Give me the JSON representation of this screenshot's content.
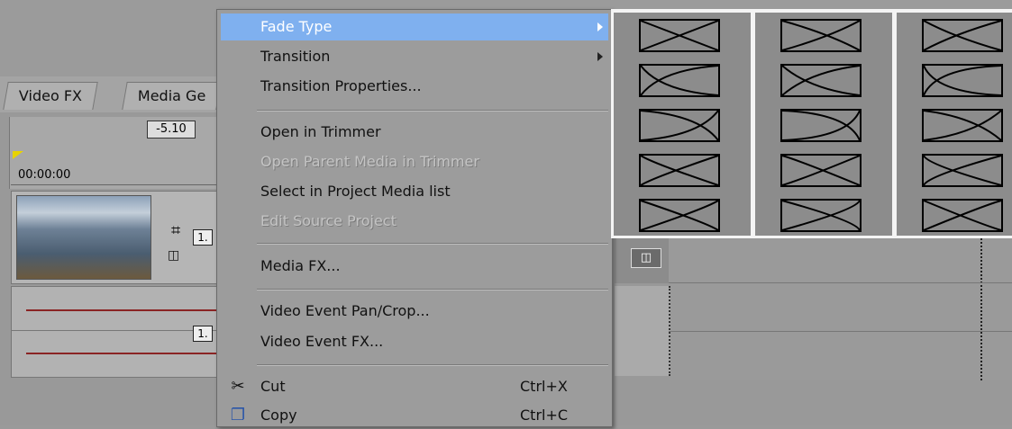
{
  "tabs": [
    {
      "label": "Video FX"
    },
    {
      "label": "Media Ge"
    }
  ],
  "timeline": {
    "time_badge": "-5.10",
    "timecode": "00:00:00",
    "event_label_1": "1.",
    "event_label_2": "1."
  },
  "menu": {
    "items": [
      {
        "label": "Fade Type",
        "submenu": true,
        "state": "highlighted"
      },
      {
        "label": "Transition",
        "submenu": true
      },
      {
        "label": "Transition Properties..."
      },
      {
        "label": "Open in Trimmer"
      },
      {
        "label": "Open Parent Media in Trimmer",
        "state": "disabled"
      },
      {
        "label": "Select in Project Media list"
      },
      {
        "label": "Edit Source Project",
        "state": "disabled"
      },
      {
        "label": "Media FX..."
      },
      {
        "label": "Video Event Pan/Crop..."
      },
      {
        "label": "Video Event FX..."
      },
      {
        "label": "Cut",
        "shortcut": "Ctrl+X",
        "icon": "scissors-icon"
      },
      {
        "label": "Copy",
        "shortcut": "Ctrl+C",
        "icon": "copy-icon"
      }
    ]
  },
  "fade_submenu": {
    "columns": 3,
    "rows": 5
  },
  "colors": {
    "highlight": "#7fb0ef",
    "menu_bg": "#9c9c9c",
    "envelope": "#8a2424"
  }
}
